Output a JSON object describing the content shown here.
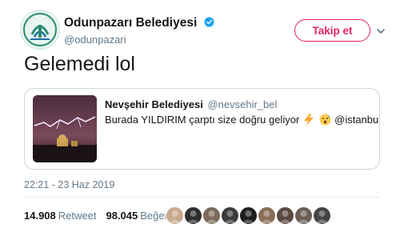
{
  "author": {
    "display_name": "Odunpazarı Belediyesi",
    "handle": "@odunpazari",
    "verified": true,
    "avatar_icon": "municipality-logo-icon"
  },
  "follow_button": {
    "label": "Takip et",
    "color": "#e0245e"
  },
  "menu_icon": "chevron-down-icon",
  "tweet": {
    "text": "Gelemedi lol"
  },
  "quoted_tweet": {
    "display_name": "Nevşehir Belediyesi",
    "handle": "@nevsehir_bel",
    "text_before": "Burada YILDIRIM çarptı size doğru geliyor",
    "emojis": [
      "lightning-emoji-icon",
      "surprised-face-emoji-icon"
    ],
    "mention": "@istanbulbld",
    "image_icon": "lightning-photo-icon"
  },
  "timestamp": "22:21 - 23 Haz 2019",
  "stats": {
    "retweets": {
      "count": "14.908",
      "label": "Retweet"
    },
    "likes": {
      "count": "98.045",
      "label": "Beğeni"
    }
  },
  "likers": [
    {
      "color": "#c9a98e",
      "icon": "liker-avatar-icon"
    },
    {
      "color": "#2d2d2d",
      "icon": "liker-avatar-icon"
    },
    {
      "color": "#7d6a5a",
      "icon": "liker-avatar-icon"
    },
    {
      "color": "#3b3b3b",
      "icon": "liker-avatar-icon"
    },
    {
      "color": "#1e1e1e",
      "icon": "liker-avatar-icon"
    },
    {
      "color": "#8a6d55",
      "icon": "liker-avatar-icon"
    },
    {
      "color": "#5a4a42",
      "icon": "liker-avatar-icon"
    },
    {
      "color": "#6b5e55",
      "icon": "liker-avatar-icon"
    },
    {
      "color": "#444444",
      "icon": "liker-avatar-icon"
    }
  ],
  "colors": {
    "text": "#14171a",
    "secondary": "#657786",
    "border": "#ccd6dd",
    "verified": "#1da1f2"
  }
}
